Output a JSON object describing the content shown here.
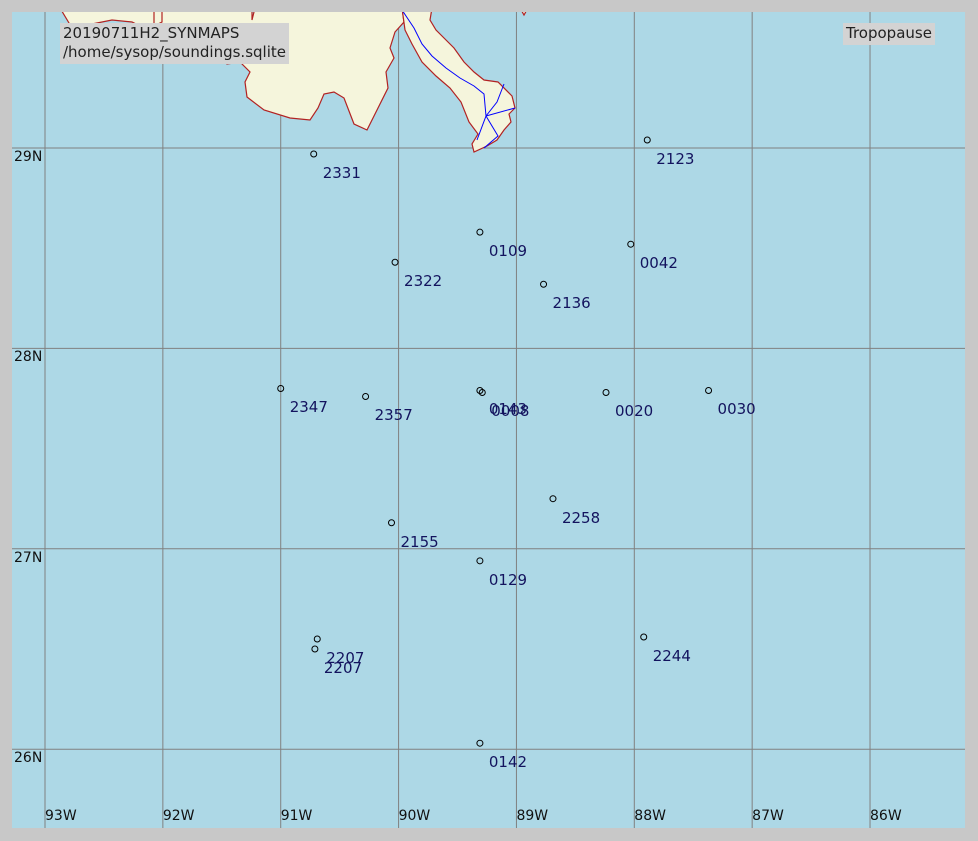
{
  "header": {
    "dataset": "20190711H2_SYNMAPS",
    "database": "/home/sysop/soundings.sqlite",
    "level": "Tropopause"
  },
  "colors": {
    "ocean": "#add8e6",
    "land": "#f5f5dc",
    "coastline": "#b22222",
    "river": "#0000ff",
    "gridline": "#808080",
    "station_label": "#13135e"
  },
  "grid": {
    "latitudes": [
      "29N",
      "28N",
      "27N",
      "26N"
    ],
    "longitudes": [
      "93W",
      "92W",
      "91W",
      "90W",
      "89W",
      "88W",
      "87W",
      "86W"
    ]
  },
  "stations": [
    {
      "label": "2331",
      "lon": -90.72,
      "lat": 28.97
    },
    {
      "label": "2123",
      "lon": -87.89,
      "lat": 29.04
    },
    {
      "label": "0109",
      "lon": -89.31,
      "lat": 28.58
    },
    {
      "label": "2322",
      "lon": -90.03,
      "lat": 28.43
    },
    {
      "label": "0042",
      "lon": -88.03,
      "lat": 28.52
    },
    {
      "label": "2136",
      "lon": -88.77,
      "lat": 28.32
    },
    {
      "label": "2347",
      "lon": -91.0,
      "lat": 27.8
    },
    {
      "label": "2357",
      "lon": -90.28,
      "lat": 27.76
    },
    {
      "label": "0143",
      "lon": -89.31,
      "lat": 27.79
    },
    {
      "label": "0008",
      "lon": -89.29,
      "lat": 27.78
    },
    {
      "label": "0020",
      "lon": -88.24,
      "lat": 27.78
    },
    {
      "label": "0030",
      "lon": -87.37,
      "lat": 27.79
    },
    {
      "label": "2258",
      "lon": -88.69,
      "lat": 27.25
    },
    {
      "label": "2155",
      "lon": -90.06,
      "lat": 27.13
    },
    {
      "label": "0129",
      "lon": -89.31,
      "lat": 26.94
    },
    {
      "label": "2207",
      "lon": -90.69,
      "lat": 26.55
    },
    {
      "label": "2207",
      "lon": -90.71,
      "lat": 26.5
    },
    {
      "label": "2244",
      "lon": -87.92,
      "lat": 26.56
    },
    {
      "label": "0142",
      "lon": -89.31,
      "lat": 26.03
    }
  ]
}
